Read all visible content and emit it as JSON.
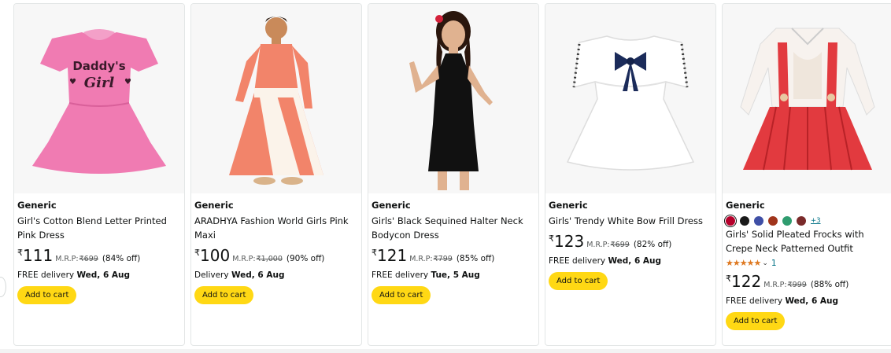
{
  "products": [
    {
      "brand": "Generic",
      "title": "Girl's Cotton Blend Letter Printed Pink Dress",
      "currency": "₹",
      "price": "111",
      "mrp_label": "M.R.P:",
      "mrp": "₹699",
      "discount": "(84% off)",
      "delivery_prefix": "FREE delivery",
      "delivery_date": "Wed, 6 Aug",
      "add_to_cart": "Add to cart",
      "image_text_1": "Daddy's",
      "image_text_2": "Girl"
    },
    {
      "brand": "Generic",
      "title": "ARADHYA Fashion World Girls Pink Maxi",
      "currency": "₹",
      "price": "100",
      "mrp_label": "M.R.P:",
      "mrp": "₹1,000",
      "discount": "(90% off)",
      "delivery_prefix": "Delivery",
      "delivery_date": "Wed, 6 Aug",
      "add_to_cart": "Add to cart"
    },
    {
      "brand": "Generic",
      "title": "Girls' Black Sequined Halter Neck Bodycon Dress",
      "currency": "₹",
      "price": "121",
      "mrp_label": "M.R.P:",
      "mrp": "₹799",
      "discount": "(85% off)",
      "delivery_prefix": "FREE delivery",
      "delivery_date": "Tue, 5 Aug",
      "add_to_cart": "Add to cart"
    },
    {
      "brand": "Generic",
      "title": "Girls' Trendy White Bow Frill Dress",
      "currency": "₹",
      "price": "123",
      "mrp_label": "M.R.P:",
      "mrp": "₹699",
      "discount": "(82% off)",
      "delivery_prefix": "FREE delivery",
      "delivery_date": "Wed, 6 Aug",
      "add_to_cart": "Add to cart"
    },
    {
      "brand": "Generic",
      "title": "Girls' Solid Pleated Frocks with Crepe Neck Patterned Outfit",
      "currency": "₹",
      "price": "122",
      "mrp_label": "M.R.P:",
      "mrp": "₹999",
      "discount": "(88% off)",
      "delivery_prefix": "FREE delivery",
      "delivery_date": "Wed, 6 Aug",
      "add_to_cart": "Add to cart",
      "swatch_colors": [
        "#b5002b",
        "#1a1a1a",
        "#3f4fa6",
        "#a0341b",
        "#2f9c6f",
        "#7a2a2a"
      ],
      "more_colors": "+3",
      "stars": "★★★★★",
      "rating_count": "1"
    }
  ],
  "colors": {
    "button": "#ffd814",
    "link": "#007185",
    "star": "#de7921",
    "muted": "#565959"
  }
}
